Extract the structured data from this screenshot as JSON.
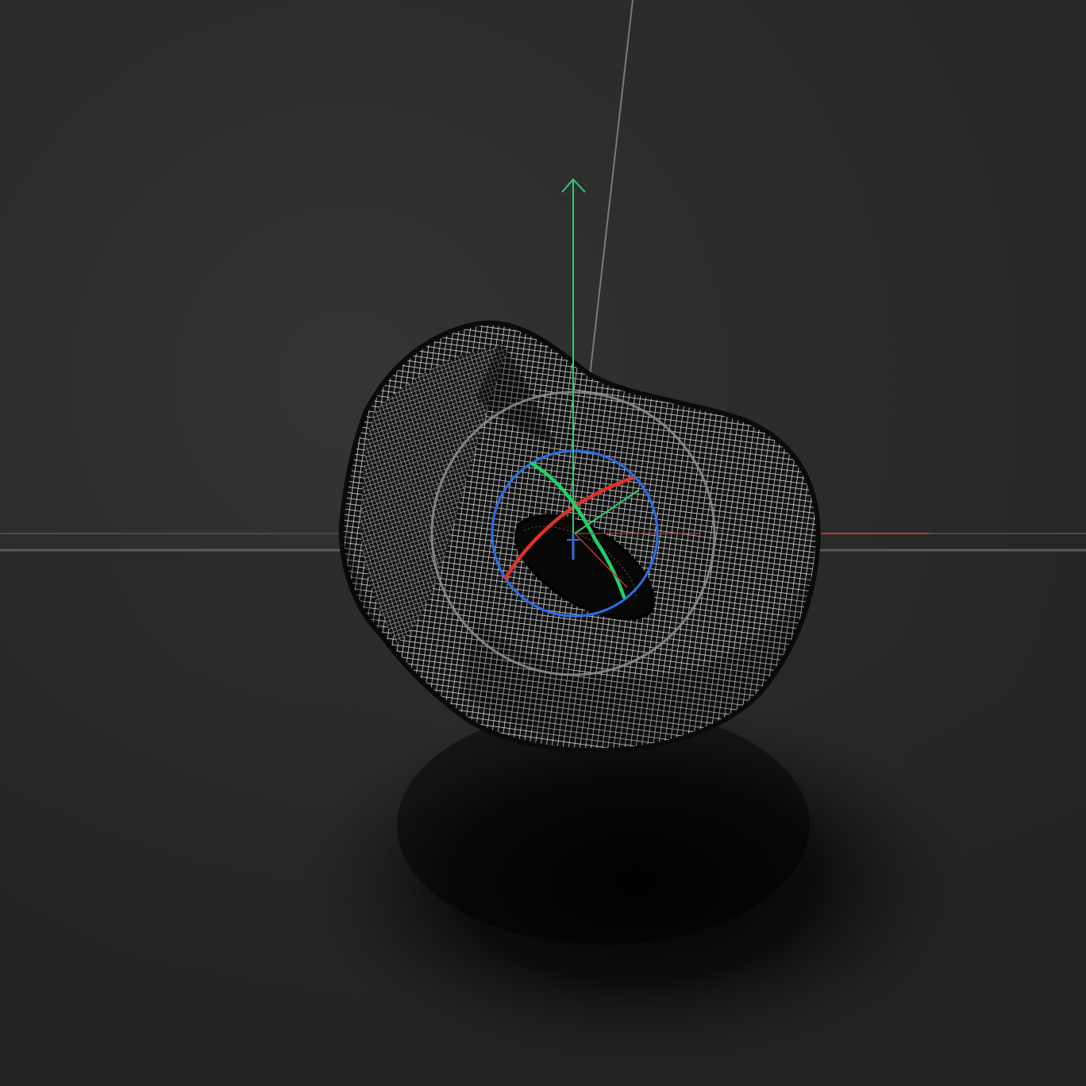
{
  "viewport": {
    "mode": "3d-viewport",
    "display": "wireframe",
    "object": "deformed-torus",
    "colors": {
      "background": "#2b2b2b",
      "horizon": "#5a5a5a",
      "axis_x": "#c0392b",
      "axis_y": "#2ecc71",
      "axis_z": "#2f6fd6",
      "gizmo_ring_x": "#e0302a",
      "gizmo_ring_y": "#1fd163",
      "gizmo_ring_z": "#2a6ee8",
      "rotate_trackball_ring": "#9a9a9a",
      "mesh_wire": "#e6e6e6",
      "mesh_body": "#0d0d0d"
    }
  },
  "gizmo": {
    "type": "rotate-gizmo",
    "axes": [
      "x",
      "y",
      "z"
    ]
  }
}
